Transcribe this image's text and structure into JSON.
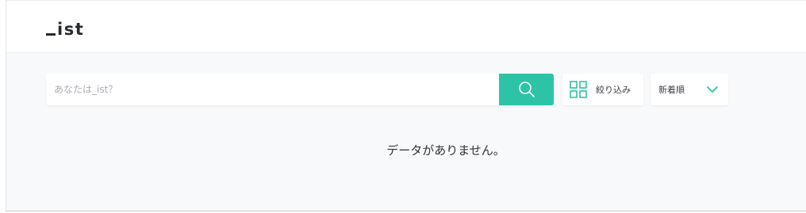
{
  "header": {
    "logo_text": "ist"
  },
  "search": {
    "placeholder": "あなたは_ist？",
    "value": ""
  },
  "filter": {
    "label": "絞り込み"
  },
  "sort": {
    "selected": "新着順"
  },
  "results": {
    "empty_message": "データがありません。"
  },
  "colors": {
    "accent": "#2cc3a7",
    "text": "#2f3338",
    "background": "#f8f9fa"
  },
  "icons": {
    "search": "search-icon",
    "filter": "grid-icon",
    "sort": "chevron-down-icon"
  }
}
